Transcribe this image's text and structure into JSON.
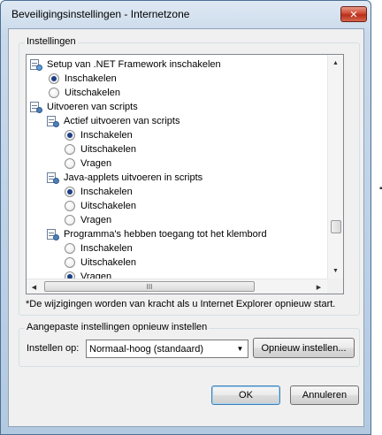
{
  "window": {
    "title": "Beveiligingsinstellingen - Internetzone",
    "close_glyph": "✕"
  },
  "settings": {
    "group_label": "Instellingen",
    "items": [
      {
        "type": "feature",
        "icon": "dotnet-setup-icon",
        "label": "Setup van .NET Framework inschakelen",
        "indent": 0
      },
      {
        "type": "option",
        "label": "Inschakelen",
        "checked": true,
        "indent": 0
      },
      {
        "type": "option",
        "label": "Uitschakelen",
        "checked": false,
        "indent": 0
      },
      {
        "type": "feature",
        "icon": "script-settings-icon",
        "label": "Uitvoeren van scripts",
        "indent": 0
      },
      {
        "type": "feature",
        "icon": "script-settings-icon",
        "label": "Actief uitvoeren van scripts",
        "indent": 1
      },
      {
        "type": "option",
        "label": "Inschakelen",
        "checked": true,
        "indent": 1
      },
      {
        "type": "option",
        "label": "Uitschakelen",
        "checked": false,
        "indent": 1
      },
      {
        "type": "option",
        "label": "Vragen",
        "checked": false,
        "indent": 1
      },
      {
        "type": "feature",
        "icon": "script-settings-icon",
        "label": "Java-applets uitvoeren in scripts",
        "indent": 1
      },
      {
        "type": "option",
        "label": "Inschakelen",
        "checked": true,
        "indent": 1
      },
      {
        "type": "option",
        "label": "Uitschakelen",
        "checked": false,
        "indent": 1
      },
      {
        "type": "option",
        "label": "Vragen",
        "checked": false,
        "indent": 1
      },
      {
        "type": "feature",
        "icon": "script-settings-icon",
        "label": "Programma's hebben toegang tot het klembord",
        "indent": 1
      },
      {
        "type": "option",
        "label": "Inschakelen",
        "checked": false,
        "indent": 1
      },
      {
        "type": "option",
        "label": "Uitschakelen",
        "checked": false,
        "indent": 1
      },
      {
        "type": "option",
        "label": "Vragen",
        "checked": true,
        "indent": 1
      }
    ],
    "scroll_thumb_glyph": "III",
    "note": "*De wijzigingen worden van kracht als u Internet Explorer opnieuw start."
  },
  "reset": {
    "group_label": "Aangepaste instellingen opnieuw instellen",
    "reset_to_label": "Instellen op:",
    "selected_level": "Normaal-hoog (standaard)",
    "reset_button": "Opnieuw instellen..."
  },
  "footer": {
    "ok_button": "OK",
    "cancel_button": "Annuleren"
  },
  "colors": {
    "titlebar": "#c9d9ea",
    "radio_dot": "#1d3f86",
    "default_button_border": "#3c7fb1"
  }
}
